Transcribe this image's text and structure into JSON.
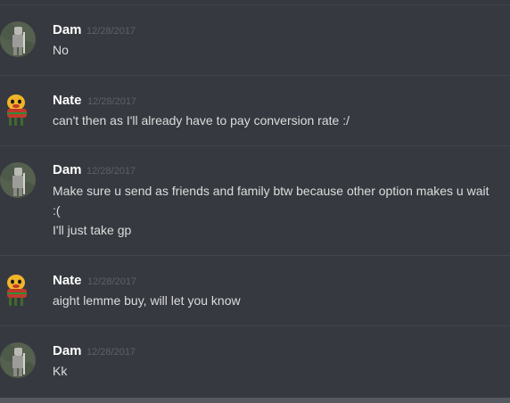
{
  "messages": [
    {
      "author": "Dam",
      "timestamp": "12/28/2017",
      "lines": [
        "No"
      ]
    },
    {
      "author": "Nate",
      "timestamp": "12/28/2017",
      "lines": [
        "can't then as I'll already have to pay conversion rate :/"
      ]
    },
    {
      "author": "Dam",
      "timestamp": "12/28/2017",
      "lines": [
        "Make sure u send as friends and family btw because other option makes u wait",
        ":(",
        "I'll just take gp"
      ]
    },
    {
      "author": "Nate",
      "timestamp": "12/28/2017",
      "lines": [
        "aight lemme buy, will let you know"
      ]
    },
    {
      "author": "Dam",
      "timestamp": "12/28/2017",
      "lines": [
        "Kk"
      ]
    }
  ],
  "colors": {
    "background": "#36393f",
    "username": "#ffffff",
    "timestamp": "#5d6068",
    "message_text": "#dcddde",
    "divider": "#42454b"
  },
  "icons": {
    "dam_avatar": "knight-avatar-icon",
    "nate_avatar": "cartoon-dog-avatar-icon"
  }
}
